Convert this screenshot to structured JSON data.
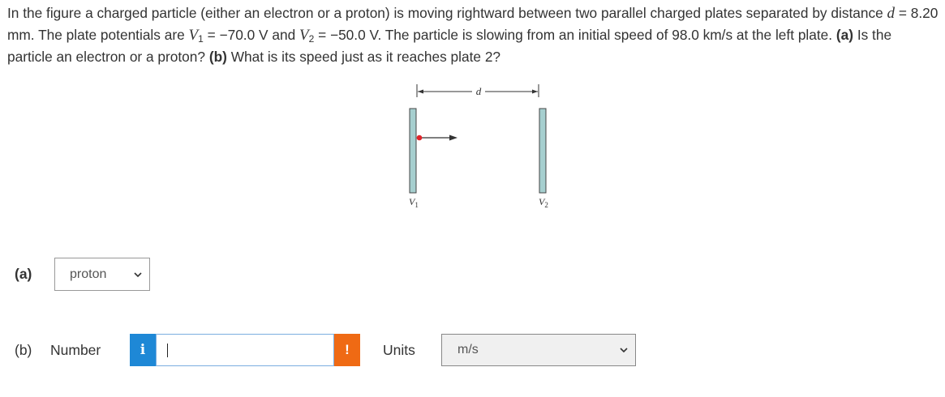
{
  "question": {
    "text_1": "In the figure a charged particle (either an electron or a proton) is moving rightward between two parallel charged plates separated by distance ",
    "d_symbol": "d",
    "text_2": " = 8.20 mm. The plate potentials are ",
    "v_symbol": "V",
    "sub_1": "1",
    "text_3": " = −70.0 V and ",
    "sub_2": "2",
    "text_4": " = −50.0 V. The particle is slowing from an initial speed of 98.0 km/s at the left plate. ",
    "part_a_marker": "(a)",
    "part_a_text": " Is the particle an electron or a proton? ",
    "part_b_marker": "(b)",
    "part_b_text": " What is its speed just as it reaches plate 2?"
  },
  "figure": {
    "d_label": "d",
    "v_label": "V",
    "v1_sub": "1",
    "v2_sub": "2",
    "plate_color": "#a6cfcf",
    "particle_color": "#e0242a"
  },
  "part_a": {
    "label": "(a)",
    "selected": "proton"
  },
  "part_b": {
    "label": "(b)",
    "number_label": "Number",
    "info_icon": "i",
    "input_value": "",
    "warning_icon": "!",
    "units_label": "Units",
    "units_selected": "m/s"
  }
}
